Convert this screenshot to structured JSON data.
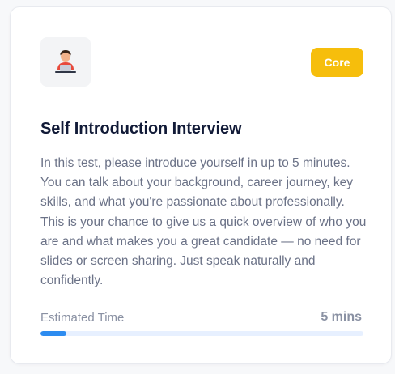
{
  "card": {
    "icon": "person-at-laptop-icon",
    "badge": "Core",
    "title": "Self Introduction Interview",
    "description": "In this test, please introduce yourself in up to 5 minutes. You can talk about your background, career journey, key skills, and what you're passionate about professionally. This is your chance to give us a quick overview of who you are and what makes you a great candidate — no need for slides or screen sharing. Just speak naturally and confidently.",
    "estimated_time_label": "Estimated Time",
    "estimated_time_value": "5 mins",
    "progress_fraction": 0.08
  },
  "colors": {
    "badge": "#f6be0c",
    "title": "#111a37",
    "progress_fill": "#2d8cf0",
    "progress_track": "#e7f0ff"
  }
}
